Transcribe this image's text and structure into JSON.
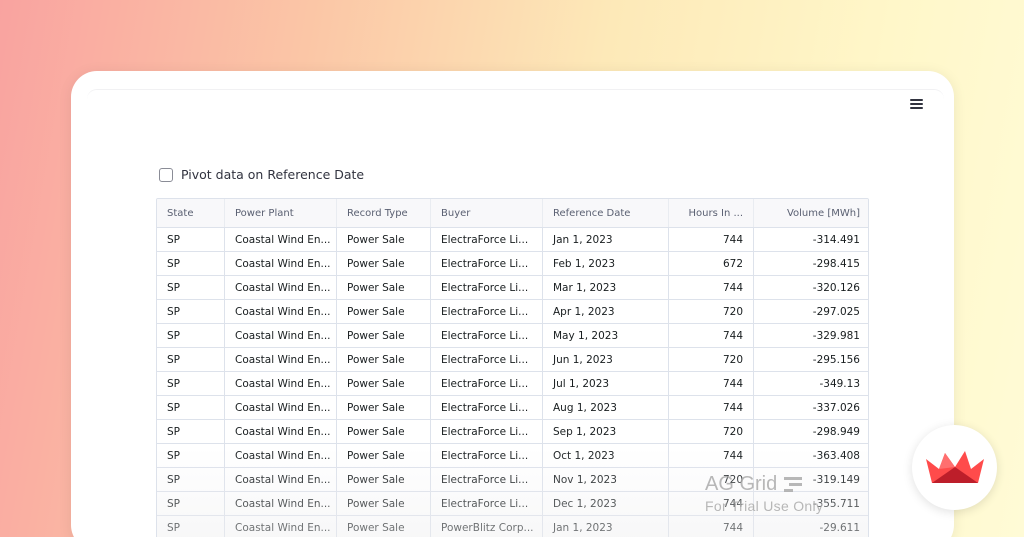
{
  "app": {
    "checkbox_label": "Pivot data on Reference Date"
  },
  "grid": {
    "columns": [
      "State",
      "Power Plant",
      "Record Type",
      "Buyer",
      "Reference Date",
      "Hours In ...",
      "Volume [MWh]"
    ],
    "rows": [
      [
        "SP",
        "Coastal Wind En...",
        "Power Sale",
        "ElectraForce Li...",
        "Jan 1, 2023",
        "744",
        "-314.491"
      ],
      [
        "SP",
        "Coastal Wind En...",
        "Power Sale",
        "ElectraForce Li...",
        "Feb 1, 2023",
        "672",
        "-298.415"
      ],
      [
        "SP",
        "Coastal Wind En...",
        "Power Sale",
        "ElectraForce Li...",
        "Mar 1, 2023",
        "744",
        "-320.126"
      ],
      [
        "SP",
        "Coastal Wind En...",
        "Power Sale",
        "ElectraForce Li...",
        "Apr 1, 2023",
        "720",
        "-297.025"
      ],
      [
        "SP",
        "Coastal Wind En...",
        "Power Sale",
        "ElectraForce Li...",
        "May 1, 2023",
        "744",
        "-329.981"
      ],
      [
        "SP",
        "Coastal Wind En...",
        "Power Sale",
        "ElectraForce Li...",
        "Jun 1, 2023",
        "720",
        "-295.156"
      ],
      [
        "SP",
        "Coastal Wind En...",
        "Power Sale",
        "ElectraForce Li...",
        "Jul 1, 2023",
        "744",
        "-349.13"
      ],
      [
        "SP",
        "Coastal Wind En...",
        "Power Sale",
        "ElectraForce Li...",
        "Aug 1, 2023",
        "744",
        "-337.026"
      ],
      [
        "SP",
        "Coastal Wind En...",
        "Power Sale",
        "ElectraForce Li...",
        "Sep 1, 2023",
        "720",
        "-298.949"
      ],
      [
        "SP",
        "Coastal Wind En...",
        "Power Sale",
        "ElectraForce Li...",
        "Oct 1, 2023",
        "744",
        "-363.408"
      ],
      [
        "SP",
        "Coastal Wind En...",
        "Power Sale",
        "ElectraForce Li...",
        "Nov 1, 2023",
        "720",
        "-319.149"
      ],
      [
        "SP",
        "Coastal Wind En...",
        "Power Sale",
        "ElectraForce Li...",
        "Dec 1, 2023",
        "744",
        "-355.711"
      ],
      [
        "SP",
        "Coastal Wind En...",
        "Power Sale",
        "PowerBlitz Corp...",
        "Jan 1, 2023",
        "744",
        "-29.611"
      ]
    ]
  },
  "watermark": {
    "title": "AG Grid",
    "subtitle": "For Trial Use Only"
  },
  "icons": {
    "menu": "hamburger-menu-icon",
    "badge": "streamlit-crown-icon"
  },
  "colors": {
    "accent": "#ff4b4b",
    "grid_border": "#dde2eb"
  }
}
